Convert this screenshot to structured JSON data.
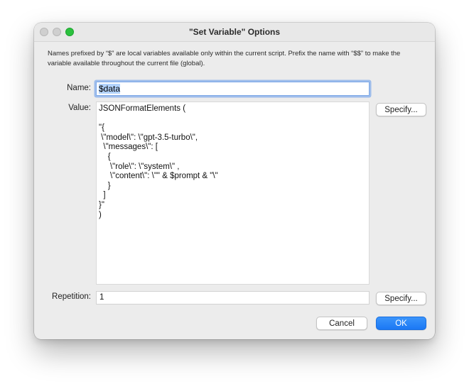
{
  "window": {
    "title": "\"Set Variable\" Options"
  },
  "description": "Names prefixed by “$” are local variables available only within the current script. Prefix the name with “$$” to make the variable available throughout the current file (global).",
  "name": {
    "label": "Name:",
    "value": "$data"
  },
  "value": {
    "label": "Value:",
    "text": "JSONFormatElements (\n\n\"{\n \\\"model\\\": \\\"gpt-3.5-turbo\\\",\n  \\\"messages\\\": [\n    {\n     \\\"role\\\": \\\"system\\\" ,\n     \\\"content\\\": \\\"\" & $prompt & \"\\\"\n    }\n  ]\n}\"\n)",
    "specify_label": "Specify..."
  },
  "repetition": {
    "label": "Repetition:",
    "value": "1",
    "specify_label": "Specify..."
  },
  "buttons": {
    "cancel": "Cancel",
    "ok": "OK"
  },
  "colors": {
    "accent": "#1b78f4",
    "zoom": "#2bc13e"
  }
}
